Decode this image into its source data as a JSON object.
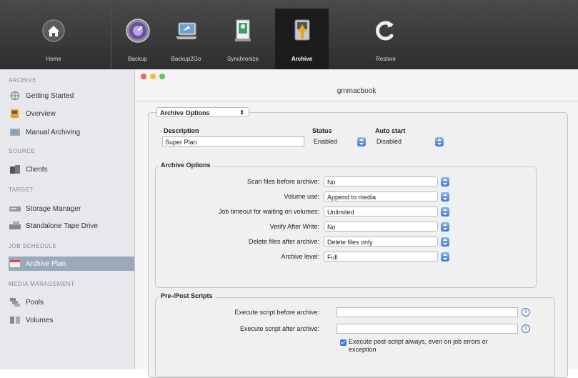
{
  "toolbar": {
    "home": "Home",
    "backup": "Backup",
    "backup2go": "Backup2Go",
    "synchronize": "Synchronize",
    "archive": "Archive",
    "restore": "Restore"
  },
  "sidebar": {
    "archive_header": "ARCHIVE",
    "getting_started": "Getting Started",
    "overview": "Overview",
    "manual_archiving": "Manual Archiving",
    "source_header": "SOURCE",
    "clients": "Clients",
    "target_header": "TARGET",
    "storage_manager": "Storage Manager",
    "standalone_tape_drive": "Standalone Tape Drive",
    "job_schedule_header": "JOB SCHEDULE",
    "archive_plan": "Archive Plan",
    "media_management_header": "MEDIA MANAGEMENT",
    "pools": "Pools",
    "volumes": "Volumes"
  },
  "window": {
    "host": "gmmacbook"
  },
  "view_selector": {
    "value": "Archive Options"
  },
  "form": {
    "description_label": "Description",
    "description_value": "Super Plan",
    "status_label": "Status",
    "status_value": "Enabled",
    "autostart_label": "Auto start",
    "autostart_value": "Disabled"
  },
  "archive_options": {
    "title": "Archive Options",
    "rows": [
      {
        "label": "Scan files before archive:",
        "value": "No"
      },
      {
        "label": "Volume use:",
        "value": "Append to media"
      },
      {
        "label": "Job timeout for waiting on volumes:",
        "value": "Unlimited"
      },
      {
        "label": "Verify After Write:",
        "value": "No"
      },
      {
        "label": "Delete files after archive:",
        "value": "Delete files only"
      },
      {
        "label": "Archive level:",
        "value": "Full"
      }
    ]
  },
  "scripts": {
    "title": "Pre-/Post Scripts",
    "before_label": "Execute script before archive:",
    "before_value": "",
    "after_label": "Execute script after archive:",
    "after_value": "",
    "always_line1": "Execute post-script always, even on job errors or",
    "always_line2": "exception"
  },
  "colors": {
    "toolbar": "#3a3a3a",
    "sidebar": "#e7e8ec",
    "selection": "#9aa8bc",
    "accent": "#3f78d6"
  }
}
